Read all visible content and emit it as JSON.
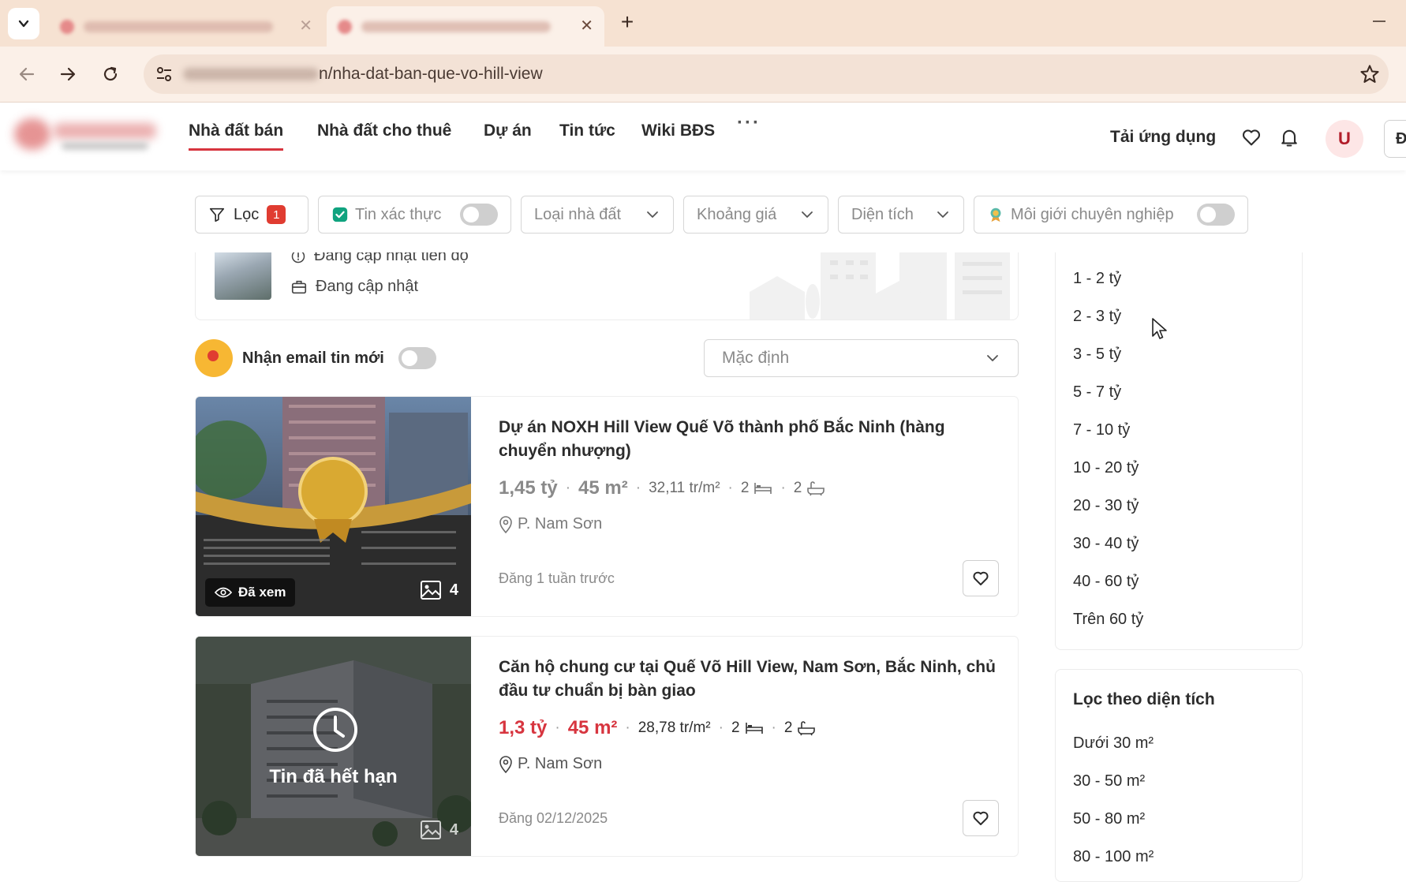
{
  "browser": {
    "tabs": [
      {
        "title": "",
        "active": false
      },
      {
        "title": "",
        "active": true
      }
    ],
    "url": "n/nha-dat-ban-que-vo-hill-view"
  },
  "header": {
    "nav": [
      "Nhà đất bán",
      "Nhà đất cho thuê",
      "Dự án",
      "Tin tức",
      "Wiki BĐS"
    ],
    "more": "···",
    "app_download": "Tải ứng dụng",
    "avatar_initial": "U",
    "post_button_letter": "Đ"
  },
  "filters": {
    "loc": {
      "label": "Lọc",
      "badge": "1"
    },
    "verified": {
      "label": "Tin xác thực"
    },
    "property_type": {
      "label": "Loại nhà đất"
    },
    "price": {
      "label": "Khoảng giá"
    },
    "area": {
      "label": "Diện tích"
    },
    "pro_agent": {
      "label": "Môi giới chuyên nghiệp"
    }
  },
  "project_card": {
    "progress": "Đang cập nhật tiến độ",
    "status": "Đang cập nhật"
  },
  "email_alert": {
    "label": "Nhận email tin mới"
  },
  "sort": {
    "selected": "Mặc định"
  },
  "listings": [
    {
      "title": "Dự án NOXH Hill View Quế Võ thành phố Bắc Ninh (hàng chuyển nhượng)",
      "price": "1,45 tỷ",
      "area": "45 m²",
      "price_per_m2": "32,11 tr/m²",
      "bedrooms": "2",
      "bathrooms": "2",
      "location": "P. Nam Sơn",
      "posted": "Đăng 1 tuần trước",
      "seen_label": "Đã xem",
      "image_count": "4",
      "expired": false
    },
    {
      "title": "Căn hộ chung cư tại Quế Võ Hill View, Nam Sơn, Bắc Ninh, chủ đầu tư chuẩn bị bàn giao",
      "price": "1,3 tỷ",
      "area": "45 m²",
      "price_per_m2": "28,78 tr/m²",
      "bedrooms": "2",
      "bathrooms": "2",
      "location": "P. Nam Sơn",
      "posted": "Đăng 02/12/2025",
      "expired_label": "Tin đã hết hạn",
      "image_count": "4",
      "expired": true
    }
  ],
  "price_filter": {
    "options": [
      "1 - 2 tỷ",
      "2 - 3 tỷ",
      "3 - 5 tỷ",
      "5 - 7 tỷ",
      "7 - 10 tỷ",
      "10 - 20 tỷ",
      "20 - 30 tỷ",
      "30 - 40 tỷ",
      "40 - 60 tỷ",
      "Trên 60 tỷ"
    ]
  },
  "area_filter": {
    "title": "Lọc theo diện tích",
    "options": [
      "Dưới 30 m²",
      "30 - 50 m²",
      "50 - 80 m²",
      "80 - 100 m²"
    ]
  },
  "colors": {
    "accent": "#d7353f",
    "tabbar": "#f6e2d2",
    "badge": "#e03c31"
  }
}
